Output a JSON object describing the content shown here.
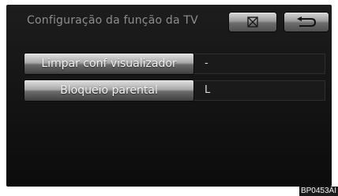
{
  "header": {
    "title": "Configuração da função da TV"
  },
  "toolbar": {
    "close_icon": "close-box-icon",
    "back_icon": "back-arrow-icon"
  },
  "settings": [
    {
      "label": "Limpar conf visualizador",
      "value": "-"
    },
    {
      "label": "Bloqueio parental",
      "value": "L"
    }
  ],
  "figure_code": "BP0453AI"
}
